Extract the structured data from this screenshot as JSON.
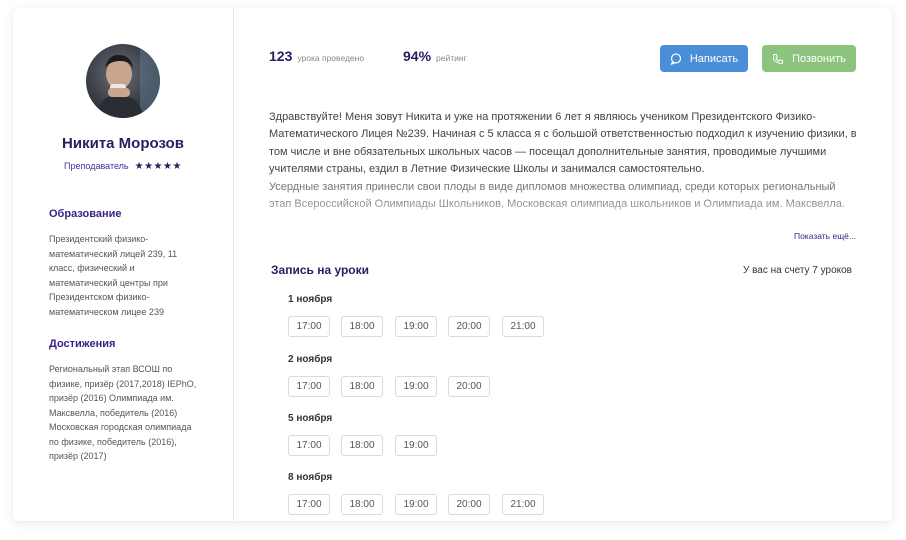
{
  "profile": {
    "name": "Никита Морозов",
    "role": "Преподаватель",
    "stars": "★★★★★"
  },
  "education": {
    "title": "Образование",
    "text": "Президентский физико-математический лицей 239, 11 класс, физический и математический центры при Президентском физико-математическом лицее 239"
  },
  "achievements": {
    "title": "Достижения",
    "text": "Региональный этап ВСОШ по физике, призёр (2017,2018) IEPhO, призёр (2016) Олимпиада им. Максвелла, победитель (2016) Московская городская олимпиада по физике, победитель (2016), призёр (2017)"
  },
  "stats": {
    "lessons_value": "123",
    "lessons_label": "урока проведено",
    "rating_value": "94%",
    "rating_label": "рейтинг"
  },
  "actions": {
    "write_label": "Написать",
    "call_label": "Позвонить",
    "write_color": "#4a8ed8",
    "call_color": "#8cc37e"
  },
  "bio": {
    "paragraph1": "Здравствуйте! Меня зовут Никита и уже на протяжении 6 лет я являюсь учеником Президентского Физико-Математического Лицея №239. Начиная с 5 класса я с большой ответственностью подходил к изучению физики, в том числе и вне обязательных школьных часов — посещал дополнительные занятия, проводимые лучшими учителями страны, ездил в Летние Физические Школы и занимался самостоятельно.",
    "paragraph2": "Усердные занятия принесли свои плоды в виде дипломов множества олимпиад, среди которых региональный этап Всероссийской Олимпиады Школьников, Московская олимпиада школьников и Олимпиада им. Максвелла.",
    "more_label": "Показать ещё..."
  },
  "booking": {
    "title": "Запись на уроки",
    "balance": "У вас на счету 7 уроков",
    "days": [
      {
        "label": "1 ноября",
        "slots": [
          "17:00",
          "18:00",
          "19:00",
          "20:00",
          "21:00"
        ]
      },
      {
        "label": "2 ноября",
        "slots": [
          "17:00",
          "18:00",
          "19:00",
          "20:00"
        ]
      },
      {
        "label": "5 ноября",
        "slots": [
          "17:00",
          "18:00",
          "19:00"
        ]
      },
      {
        "label": "8 ноября",
        "slots": [
          "17:00",
          "18:00",
          "19:00",
          "20:00",
          "21:00"
        ]
      }
    ]
  },
  "icons": {
    "chat": "chat-bubble-icon",
    "phone": "phone-icon",
    "star": "star-icon"
  },
  "colors": {
    "brand_dark": "#2e1a63",
    "accent": "#3b1f88"
  }
}
